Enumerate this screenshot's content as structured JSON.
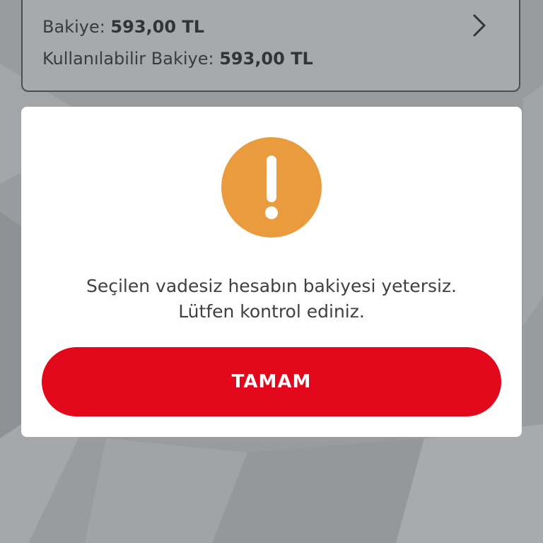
{
  "balance_card": {
    "balance_label": "Bakiye: ",
    "balance_value": "593,00 TL",
    "available_label": "Kullanılabilir Bakiye: ",
    "available_value": "593,00 TL",
    "chevron_icon": "chevron-right-icon"
  },
  "dialog": {
    "icon": "warning-icon",
    "icon_color": "#ea9b3d",
    "message_line1": "Seçilen vadesiz hesabın bakiyesi yetersiz.",
    "message_line2": "Lütfen kontrol ediniz.",
    "ok_label": "TAMAM",
    "button_color": "#e2071a"
  }
}
